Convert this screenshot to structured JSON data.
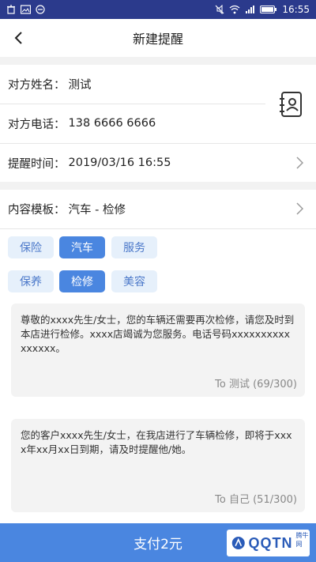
{
  "status_bar": {
    "time": "16:55"
  },
  "header": {
    "title": "新建提醒"
  },
  "form": {
    "name_label": "对方姓名：",
    "name_value": "测试",
    "phone_label": "对方电话：",
    "phone_value": "138 6666 6666",
    "time_label": "提醒时间：",
    "time_value": "2019/03/16 16:55"
  },
  "template": {
    "label": "内容模板：",
    "value": "汽车 - 检修",
    "categories": [
      "保险",
      "汽车",
      "服务"
    ],
    "subcategories": [
      "保养",
      "检修",
      "美容"
    ],
    "active_category": "汽车",
    "active_subcategory": "检修"
  },
  "messages": [
    {
      "text": "尊敬的xxxx先生/女士，您的车辆还需要再次检修，请您及时到本店进行检修。xxxx店竭诚为您服务。电话号码xxxxxxxxxxxxxxxx。",
      "recipient": "To 测试 (69/300)"
    },
    {
      "text": "您的客户xxxx先生/女士，在我店进行了车辆检修，即将于xxxx年xx月xx日到期，请及时提醒他/她。",
      "recipient": "To 自己 (51/300)"
    }
  ],
  "pay_button": "支付2元",
  "watermark": {
    "text": "QQTN",
    "sub": "腾牛网"
  },
  "colors": {
    "status_bar": "#2b3a8c",
    "accent": "#4a86e0",
    "chip_bg": "#e6f0fb"
  }
}
